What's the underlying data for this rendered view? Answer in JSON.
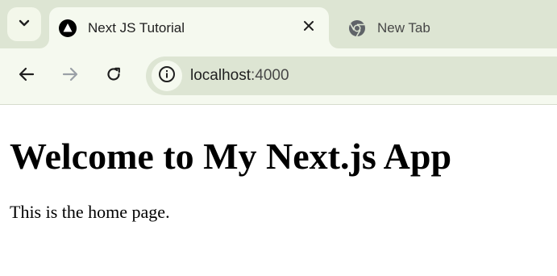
{
  "browser": {
    "tabs": [
      {
        "title": "Next JS Tutorial",
        "favicon": "nextjs-triangle-icon",
        "active": true
      },
      {
        "title": "New Tab",
        "favicon": "chrome-icon",
        "active": false
      }
    ],
    "address_bar": {
      "host": "localhost",
      "port": ":4000"
    },
    "colors": {
      "tabstrip": "#dde5d3",
      "toolbar": "#f5f9ef",
      "omnibox": "#dde5d3"
    }
  },
  "page": {
    "heading": "Welcome to My Next.js App",
    "paragraph": "This is the home page."
  }
}
